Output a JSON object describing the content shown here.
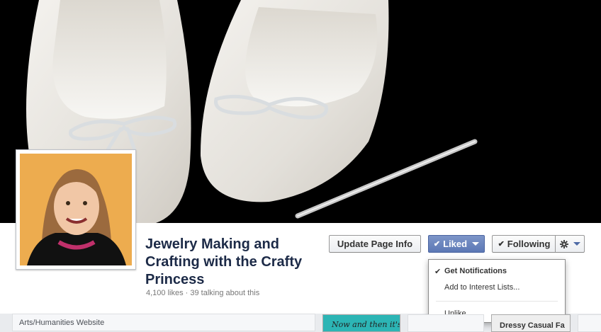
{
  "page": {
    "title": "Jewelry Making and Crafting with the Crafty Princess",
    "stats": "4,100 likes · 39 talking about this",
    "category": "Arts/Humanities Website"
  },
  "actions": {
    "update_label": "Update Page Info",
    "liked_label": "Liked",
    "following_label": "Following",
    "check_glyph": "✔",
    "gear_icon": "gear-icon"
  },
  "dropdown": {
    "items": [
      {
        "label": "Get Notifications",
        "checked": true
      },
      {
        "label": "Add to Interest Lists..."
      },
      {
        "label": "Unlike"
      }
    ]
  },
  "apps": {
    "thumb1_text": "Now and then it's",
    "thumb3_text": "Dressy Casual Fa"
  },
  "colors": {
    "brand_blue": "#5c78b5",
    "title": "#1c2a47",
    "app_teal": "#2cb5b5"
  }
}
